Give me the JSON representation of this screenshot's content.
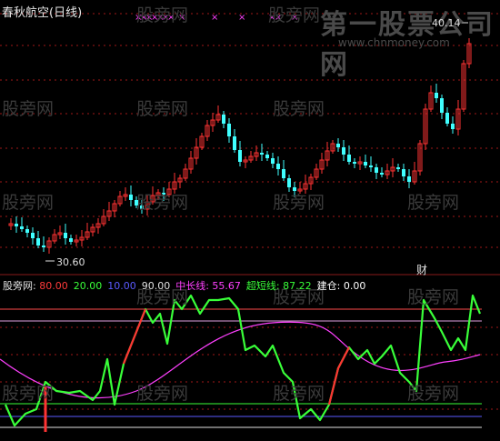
{
  "title_bar": {
    "title": "春秋航空(日线)"
  },
  "watermarks": {
    "text": "股旁网"
  },
  "branding": {
    "name": "第一股票公司网",
    "url": "www.chnmoney.com"
  },
  "price_panel": {
    "high_label": "40.14",
    "low_label": "30.60",
    "news_marker": "财",
    "crosses_count": 13
  },
  "indicator_panel": {
    "name": "股旁网",
    "items": [
      {
        "label": "",
        "value": "80.00",
        "color": "#ff3a3a"
      },
      {
        "label": "",
        "value": "20.00",
        "color": "#39ff39"
      },
      {
        "label": "",
        "value": "10.00",
        "color": "#5a5aff"
      },
      {
        "label": "",
        "value": "90.00",
        "color": "#e0e0e0"
      },
      {
        "label": "中长线",
        "value": "55.67",
        "color": "#ff40ff"
      },
      {
        "label": "超短线",
        "value": "87.22",
        "color": "#39ff39"
      },
      {
        "label": "建仓",
        "value": "0.00",
        "color": "#ffffff"
      }
    ]
  },
  "colors": {
    "up": "#ff3333",
    "down": "#40ffff",
    "grid": "#a01818",
    "mid_line": "#ff40ff",
    "short_line": "#39ff39"
  }
}
